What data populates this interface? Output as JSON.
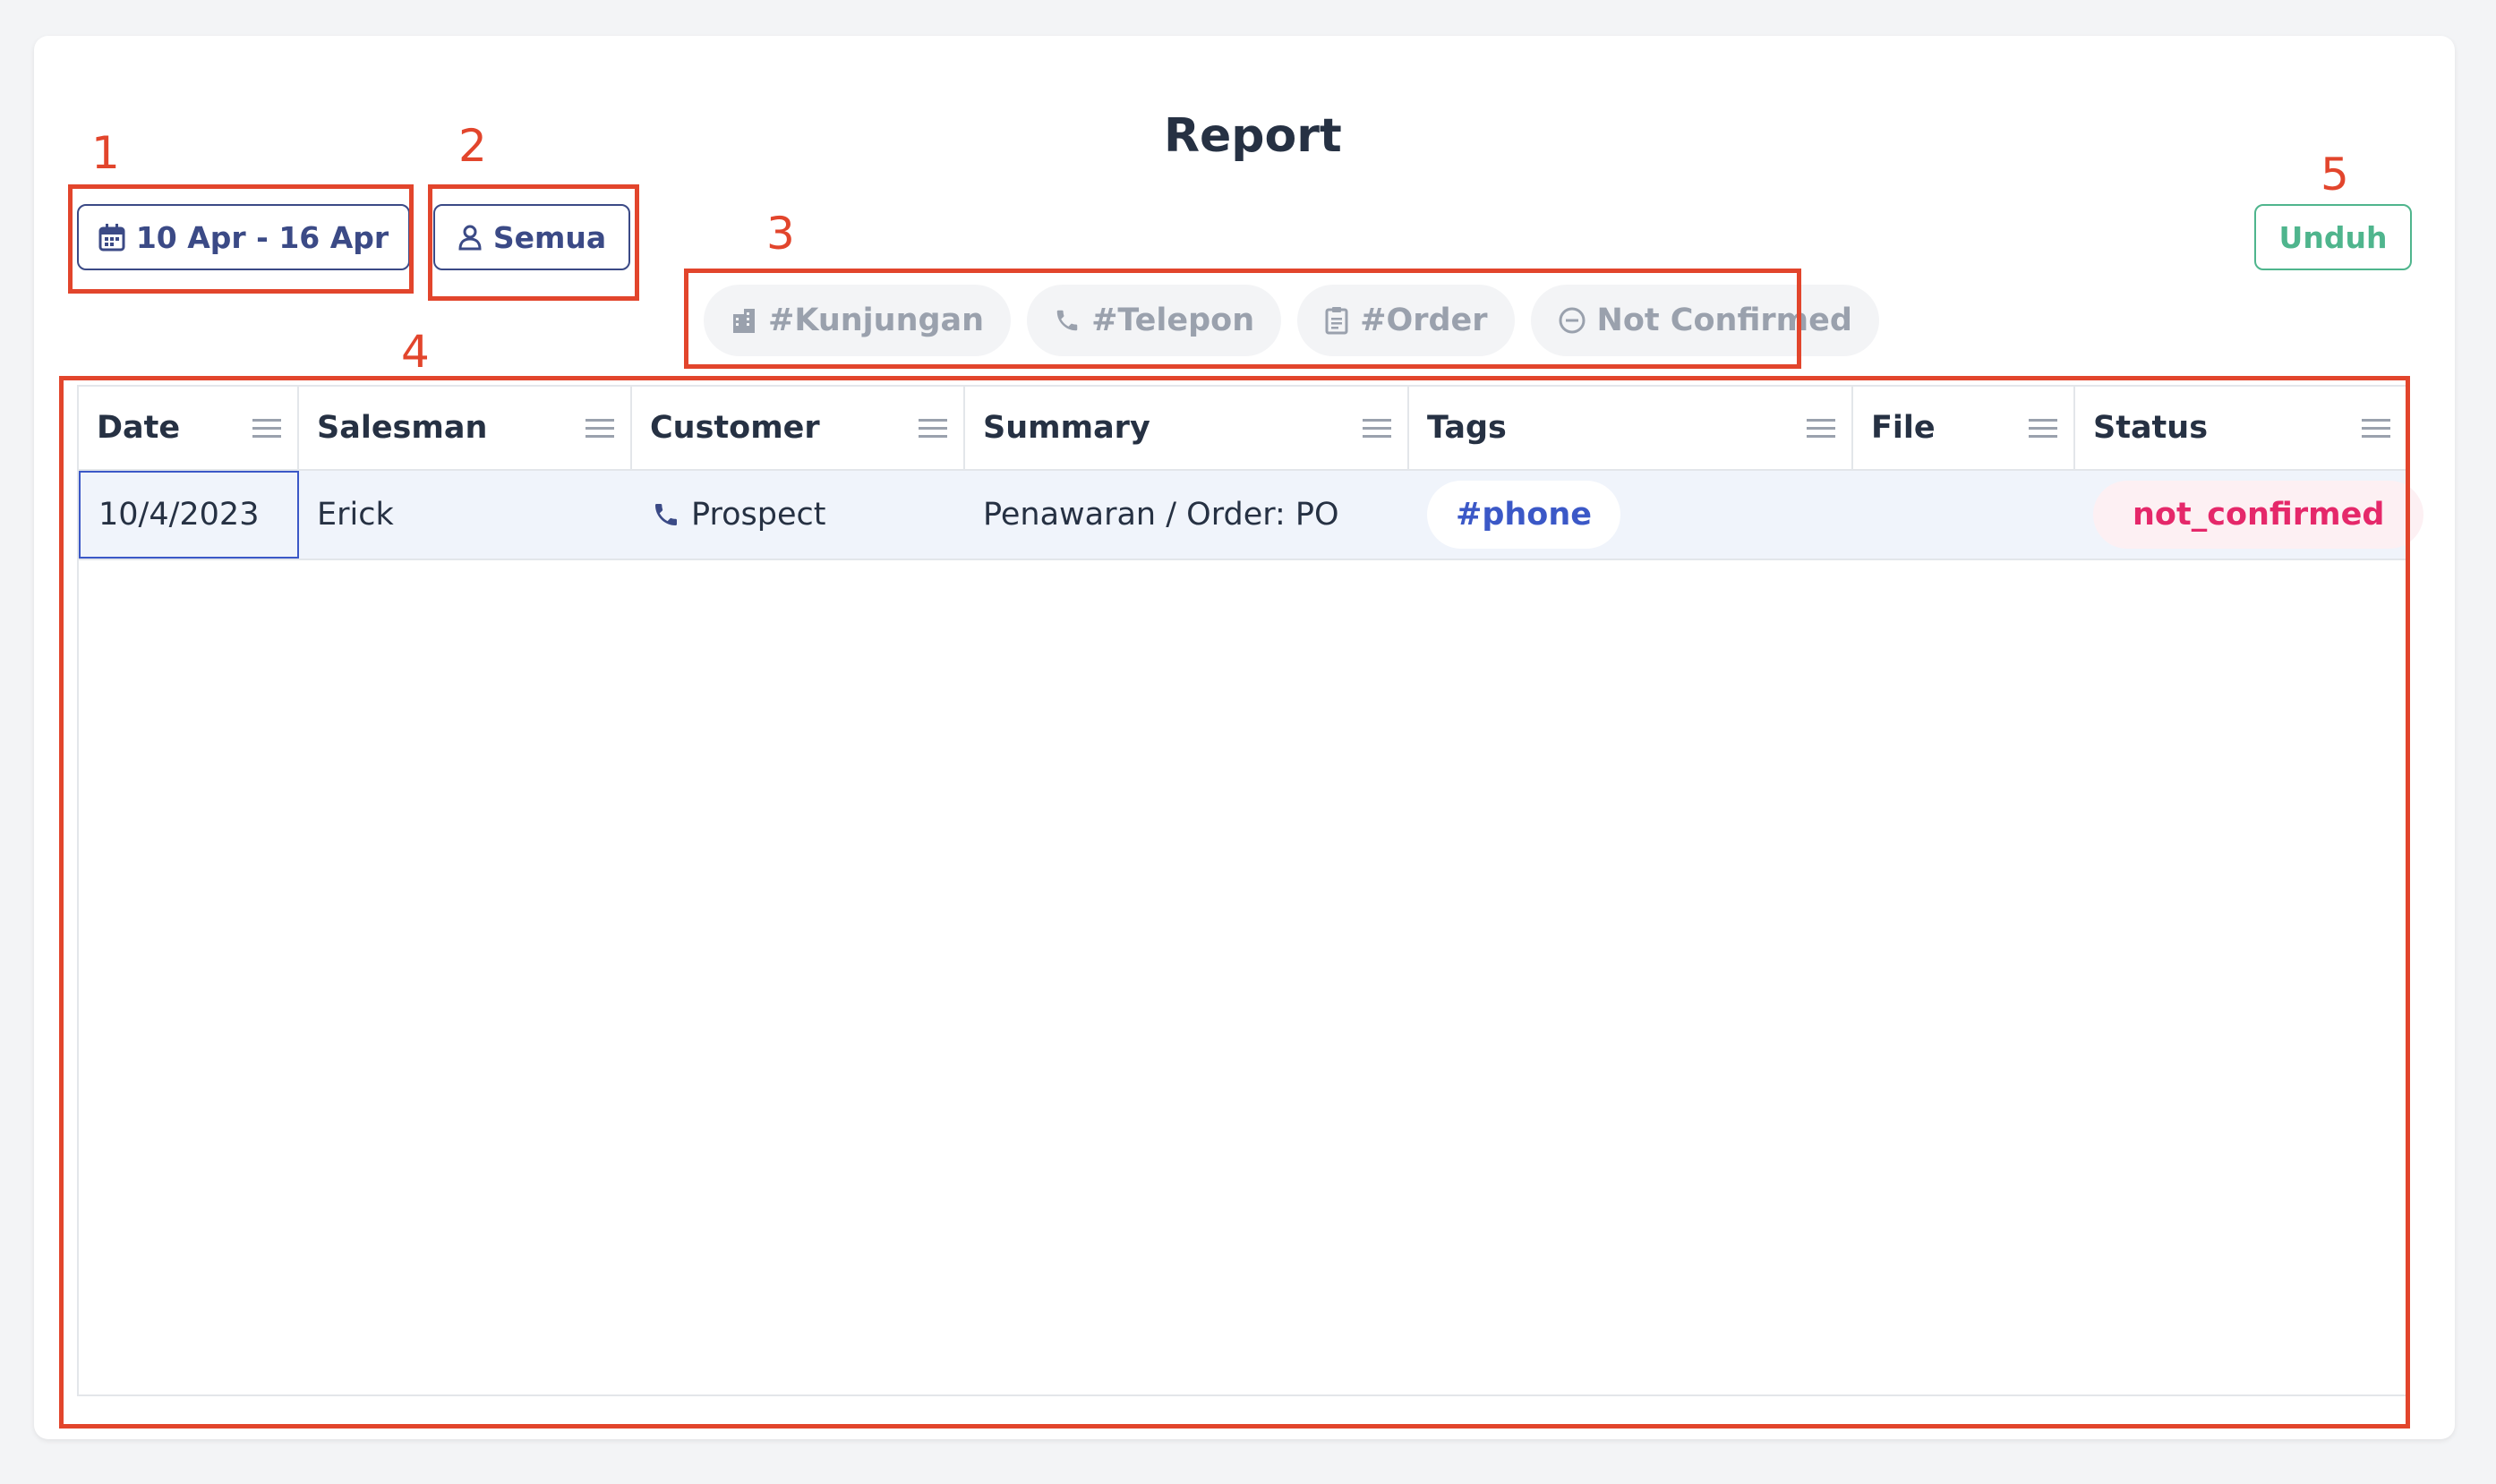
{
  "page": {
    "title": "Report"
  },
  "toolbar": {
    "date_range_label": "10 Apr - 16 Apr",
    "salesman_filter_label": "Semua",
    "download_label": "Unduh"
  },
  "filter_chips": [
    {
      "label": "#Kunjungan",
      "icon": "building-icon"
    },
    {
      "label": "#Telepon",
      "icon": "phone-icon"
    },
    {
      "label": "#Order",
      "icon": "clipboard-icon"
    },
    {
      "label": "Not Confirmed",
      "icon": "minus-circle-icon"
    }
  ],
  "table": {
    "columns": [
      "Date",
      "Salesman",
      "Customer",
      "Summary",
      "Tags",
      "File",
      "Status"
    ],
    "rows": [
      {
        "date": "10/4/2023",
        "salesman": "Erick",
        "customer": "Prospect",
        "customer_icon": "phone-icon",
        "summary": "Penawaran / Order: PO",
        "tag": "#phone",
        "file": "",
        "status": "not_confirmed"
      }
    ]
  },
  "annotations": [
    "1",
    "2",
    "3",
    "4",
    "5"
  ],
  "colors": {
    "primary": "#3b4a86",
    "download": "#4fb58d",
    "tag": "#3b58c7",
    "status_not_confirmed": "#e5286a",
    "annotation": "#e2452c",
    "chip_text": "#9aa1ad"
  }
}
